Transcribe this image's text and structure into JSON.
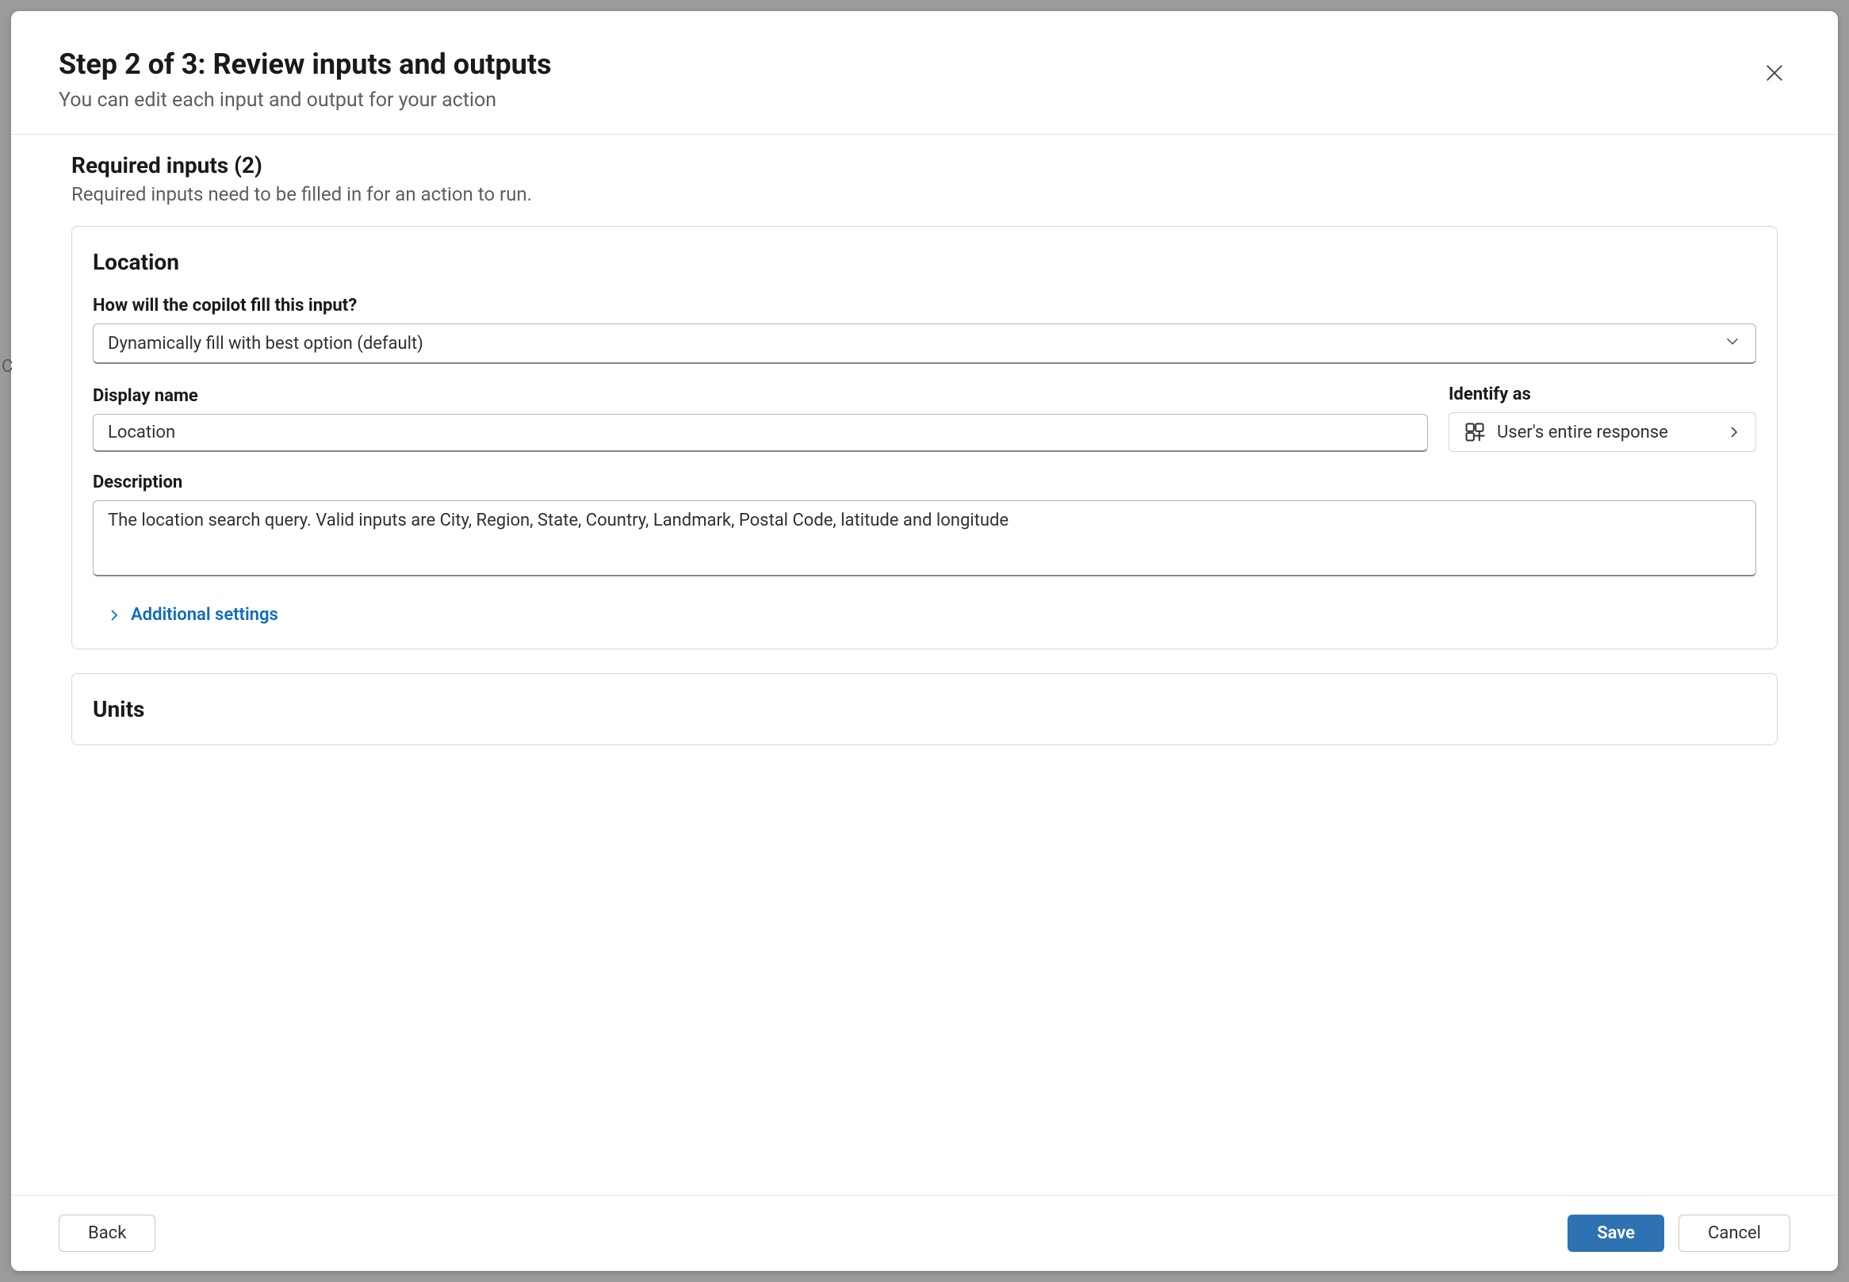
{
  "header": {
    "title": "Step 2 of 3: Review inputs and outputs",
    "subtitle": "You can edit each input and output for your action"
  },
  "required_inputs": {
    "heading": "Required inputs (2)",
    "description": "Required inputs need to be filled in for an action to run."
  },
  "inputs": [
    {
      "title": "Location",
      "fill_label": "How will the copilot fill this input?",
      "fill_value": "Dynamically fill with best option (default)",
      "display_name_label": "Display name",
      "display_name_value": "Location",
      "identify_label": "Identify as",
      "identify_value": "User's entire response",
      "description_label": "Description",
      "description_value": "The location search query. Valid inputs are City, Region, State, Country, Landmark, Postal Code, latitude and longitude",
      "additional_label": "Additional settings"
    },
    {
      "title": "Units"
    }
  ],
  "footer": {
    "back": "Back",
    "save": "Save",
    "cancel": "Cancel"
  }
}
